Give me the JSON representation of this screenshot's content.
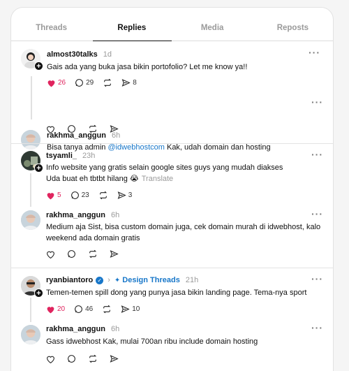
{
  "tabs": [
    {
      "label": "Threads"
    },
    {
      "label": "Replies"
    },
    {
      "label": "Media"
    },
    {
      "label": "Reposts"
    }
  ],
  "threads": [
    {
      "post": {
        "username": "almost30talks",
        "time": "1d",
        "text": "Gais ada yang buka jasa bikin portofolio? Let me know ya!!",
        "likes": "26",
        "replies": "29",
        "shares": "8"
      },
      "reply": {
        "username": "rakhma_anggun",
        "time": "6h",
        "text_before": "Bisa tanya admin ",
        "mention": "@idwebhostcom",
        "text_after": " Kak, udah domain dan hosting"
      }
    },
    {
      "post": {
        "username": "tsyamli_",
        "time": "23h",
        "line1": "Info website yang gratis selain google sites guys yang mudah diakses",
        "line2": "Uda buat eh tbtbt hilang 😭",
        "translate": "Translate",
        "likes": "5",
        "replies": "23",
        "shares": "3"
      },
      "reply": {
        "username": "rakhma_anggun",
        "time": "6h",
        "text": "Medium aja Sist, bisa custom domain juga, cek domain murah di idwebhost, kalo weekend ada domain gratis"
      }
    },
    {
      "post": {
        "username": "ryanbiantoro",
        "community": "Design Threads",
        "time": "21h",
        "text": "Temen-temen spill dong yang punya jasa bikin landing page. Tema-nya sport",
        "likes": "20",
        "replies": "46",
        "shares": "10"
      },
      "reply": {
        "username": "rakhma_anggun",
        "time": "6h",
        "text": "Gass idwebhost Kak, mulai 700an ribu include domain hosting"
      }
    }
  ],
  "colors": {
    "like": "#e0245e",
    "link": "#1877c9",
    "muted": "#9a9a9a"
  },
  "icons": [
    "heart-icon",
    "comment-icon",
    "repost-icon",
    "share-icon",
    "more-icon",
    "verified-icon",
    "follow-plus-icon"
  ]
}
